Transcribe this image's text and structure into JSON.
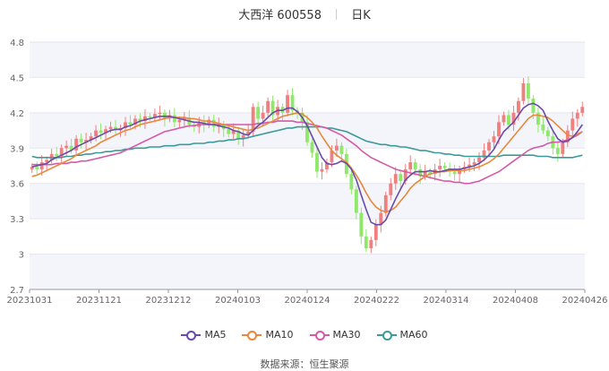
{
  "header": {
    "stock_name": "大西洋",
    "stock_code": "600558",
    "period": "日K"
  },
  "source": "数据来源：恒生聚源",
  "chart_data": {
    "type": "candlestick",
    "ylim": [
      2.7,
      4.8
    ],
    "yticks": [
      "4.8",
      "4.5",
      "4.2",
      "3.9",
      "3.6",
      "3.3",
      "3",
      "2.7"
    ],
    "x_tick_labels": [
      "20231031",
      "20231121",
      "20231212",
      "20240103",
      "20240124",
      "20240222",
      "20240314",
      "20240408",
      "20240426"
    ],
    "grid": true,
    "legend_position": "bottom",
    "colors": {
      "up": "#f07f7f",
      "down": "#8fe86a",
      "ma5": "#6a4aa8",
      "ma10": "#e8883a",
      "ma30": "#d45aa8",
      "ma60": "#3a9a9a"
    },
    "series_names": [
      "MA5",
      "MA10",
      "MA30",
      "MA60"
    ],
    "closes": [
      3.74,
      3.72,
      3.78,
      3.8,
      3.85,
      3.83,
      3.9,
      3.92,
      3.88,
      3.98,
      3.95,
      3.97,
      4.0,
      4.05,
      4.03,
      4.06,
      4.08,
      4.05,
      4.07,
      4.12,
      4.1,
      4.15,
      4.13,
      4.17,
      4.16,
      4.19,
      4.2,
      4.15,
      4.18,
      4.12,
      4.14,
      4.16,
      4.1,
      4.08,
      4.12,
      4.1,
      4.14,
      4.08,
      4.1,
      4.06,
      4.02,
      4.05,
      3.98,
      4.01,
      4.04,
      4.25,
      4.15,
      4.2,
      4.3,
      4.18,
      4.25,
      4.2,
      4.35,
      4.22,
      4.2,
      4.12,
      3.95,
      3.86,
      3.7,
      3.72,
      3.78,
      3.88,
      3.92,
      3.85,
      3.68,
      3.55,
      3.35,
      3.15,
      3.05,
      3.12,
      3.25,
      3.35,
      3.5,
      3.6,
      3.68,
      3.62,
      3.72,
      3.78,
      3.72,
      3.66,
      3.7,
      3.68,
      3.72,
      3.75,
      3.73,
      3.7,
      3.68,
      3.72,
      3.74,
      3.76,
      3.78,
      3.82,
      3.88,
      3.95,
      4.0,
      4.12,
      4.18,
      4.1,
      4.2,
      4.3,
      4.45,
      4.32,
      4.2,
      4.1,
      4.05,
      4.0,
      3.9,
      3.85,
      3.95,
      4.05,
      4.15,
      4.2,
      4.25
    ],
    "ma5": [
      3.74,
      3.75,
      3.76,
      3.77,
      3.8,
      3.82,
      3.84,
      3.86,
      3.88,
      3.91,
      3.93,
      3.95,
      3.97,
      3.99,
      4.01,
      4.03,
      4.05,
      4.06,
      4.06,
      4.08,
      4.09,
      4.11,
      4.13,
      4.14,
      4.15,
      4.16,
      4.17,
      4.17,
      4.17,
      4.16,
      4.15,
      4.14,
      4.13,
      4.12,
      4.12,
      4.11,
      4.1,
      4.1,
      4.09,
      4.08,
      4.07,
      4.05,
      4.04,
      4.02,
      4.01,
      4.05,
      4.09,
      4.12,
      4.16,
      4.2,
      4.22,
      4.22,
      4.24,
      4.24,
      4.21,
      4.16,
      4.09,
      4.0,
      3.91,
      3.82,
      3.77,
      3.76,
      3.77,
      3.79,
      3.77,
      3.72,
      3.63,
      3.5,
      3.38,
      3.27,
      3.25,
      3.25,
      3.29,
      3.38,
      3.47,
      3.55,
      3.63,
      3.67,
      3.7,
      3.7,
      3.7,
      3.71,
      3.7,
      3.7,
      3.71,
      3.72,
      3.72,
      3.72,
      3.73,
      3.74,
      3.75,
      3.77,
      3.8,
      3.84,
      3.89,
      3.97,
      4.04,
      4.08,
      4.12,
      4.18,
      4.24,
      4.27,
      4.28,
      4.26,
      4.22,
      4.13,
      4.05,
      3.98,
      3.95,
      3.96,
      3.99,
      4.04,
      4.1
    ],
    "ma10": [
      3.66,
      3.67,
      3.69,
      3.71,
      3.73,
      3.75,
      3.77,
      3.79,
      3.81,
      3.84,
      3.86,
      3.88,
      3.9,
      3.92,
      3.95,
      3.97,
      3.99,
      4.01,
      4.03,
      4.05,
      4.06,
      4.08,
      4.1,
      4.11,
      4.12,
      4.13,
      4.14,
      4.15,
      4.16,
      4.16,
      4.16,
      4.16,
      4.15,
      4.15,
      4.14,
      4.13,
      4.13,
      4.12,
      4.11,
      4.1,
      4.09,
      4.08,
      4.07,
      4.06,
      4.05,
      4.06,
      4.07,
      4.09,
      4.11,
      4.13,
      4.15,
      4.17,
      4.18,
      4.19,
      4.2,
      4.19,
      4.16,
      4.12,
      4.07,
      4.0,
      3.94,
      3.88,
      3.84,
      3.81,
      3.78,
      3.73,
      3.67,
      3.6,
      3.52,
      3.45,
      3.4,
      3.37,
      3.36,
      3.37,
      3.4,
      3.45,
      3.5,
      3.56,
      3.6,
      3.63,
      3.66,
      3.68,
      3.69,
      3.7,
      3.7,
      3.71,
      3.71,
      3.71,
      3.71,
      3.72,
      3.73,
      3.74,
      3.76,
      3.78,
      3.81,
      3.85,
      3.9,
      3.95,
      4.0,
      4.05,
      4.1,
      4.15,
      4.18,
      4.18,
      4.17,
      4.16,
      4.13,
      4.09,
      4.05,
      4.01,
      4.0,
      4.02,
      4.04
    ],
    "ma30": [
      3.76,
      3.76,
      3.76,
      3.76,
      3.76,
      3.77,
      3.77,
      3.77,
      3.78,
      3.78,
      3.79,
      3.79,
      3.8,
      3.81,
      3.82,
      3.83,
      3.84,
      3.85,
      3.86,
      3.88,
      3.9,
      3.92,
      3.94,
      3.96,
      3.98,
      4.0,
      4.02,
      4.04,
      4.05,
      4.06,
      4.07,
      4.08,
      4.09,
      4.09,
      4.1,
      4.1,
      4.1,
      4.1,
      4.1,
      4.1,
      4.1,
      4.1,
      4.1,
      4.1,
      4.1,
      4.1,
      4.11,
      4.11,
      4.12,
      4.12,
      4.13,
      4.13,
      4.13,
      4.13,
      4.12,
      4.12,
      4.11,
      4.1,
      4.09,
      4.08,
      4.07,
      4.05,
      4.03,
      4.01,
      3.98,
      3.95,
      3.92,
      3.88,
      3.85,
      3.82,
      3.8,
      3.78,
      3.76,
      3.74,
      3.72,
      3.71,
      3.7,
      3.69,
      3.68,
      3.67,
      3.66,
      3.65,
      3.64,
      3.63,
      3.62,
      3.62,
      3.61,
      3.61,
      3.6,
      3.6,
      3.61,
      3.62,
      3.64,
      3.66,
      3.68,
      3.7,
      3.73,
      3.76,
      3.79,
      3.82,
      3.85,
      3.88,
      3.9,
      3.91,
      3.92,
      3.94,
      3.95,
      3.95,
      3.96,
      3.97,
      3.99,
      4.01,
      4.04
    ],
    "ma60": [
      3.83,
      3.82,
      3.82,
      3.82,
      3.82,
      3.82,
      3.82,
      3.83,
      3.83,
      3.84,
      3.84,
      3.85,
      3.85,
      3.86,
      3.86,
      3.87,
      3.87,
      3.88,
      3.88,
      3.89,
      3.89,
      3.9,
      3.9,
      3.9,
      3.91,
      3.91,
      3.91,
      3.92,
      3.92,
      3.92,
      3.93,
      3.93,
      3.93,
      3.94,
      3.94,
      3.94,
      3.95,
      3.95,
      3.96,
      3.96,
      3.97,
      3.97,
      3.98,
      3.98,
      3.99,
      4.0,
      4.01,
      4.02,
      4.03,
      4.04,
      4.05,
      4.06,
      4.07,
      4.07,
      4.08,
      4.08,
      4.08,
      4.08,
      4.08,
      4.08,
      4.07,
      4.07,
      4.06,
      4.05,
      4.04,
      4.02,
      4.0,
      3.98,
      3.96,
      3.95,
      3.94,
      3.93,
      3.93,
      3.92,
      3.92,
      3.91,
      3.91,
      3.9,
      3.89,
      3.88,
      3.88,
      3.87,
      3.86,
      3.86,
      3.85,
      3.85,
      3.84,
      3.84,
      3.83,
      3.83,
      3.83,
      3.83,
      3.83,
      3.83,
      3.83,
      3.83,
      3.84,
      3.84,
      3.84,
      3.84,
      3.84,
      3.84,
      3.84,
      3.83,
      3.83,
      3.83,
      3.82,
      3.82,
      3.82,
      3.82,
      3.82,
      3.83,
      3.84
    ]
  }
}
